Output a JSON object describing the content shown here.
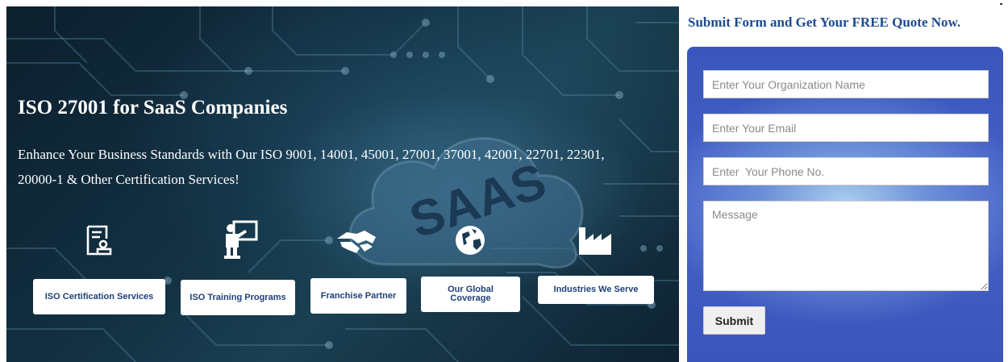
{
  "hero": {
    "title": "ISO 27001 for SaaS Companies",
    "subtitle": "Enhance Your Business Standards with Our ISO 9001, 14001, 45001, 27001, 37001, 42001, 22701, 22301, 20000-1 & Other Certification Services!",
    "background_text": "SAAS",
    "services": [
      {
        "label": "ISO Certification Services",
        "icon": "certificate-icon"
      },
      {
        "label": "ISO Training Programs",
        "icon": "trainer-icon"
      },
      {
        "label": "Franchise Partner",
        "icon": "handshake-icon"
      },
      {
        "label": "Our Global Coverage",
        "icon": "globe-icon"
      },
      {
        "label": "Industries We Serve",
        "icon": "factory-icon"
      }
    ]
  },
  "form": {
    "title": "Submit Form and Get Your FREE Quote Now.",
    "org_placeholder": "Enter Your Organization Name",
    "email_placeholder": "Enter Your Email",
    "phone_placeholder": "Enter  Your Phone No.",
    "message_placeholder": "Message",
    "submit_label": "Submit"
  },
  "colors": {
    "button_text": "#1f3f7a",
    "form_title": "#1d4b8f",
    "form_panel": "#3a56bd"
  }
}
